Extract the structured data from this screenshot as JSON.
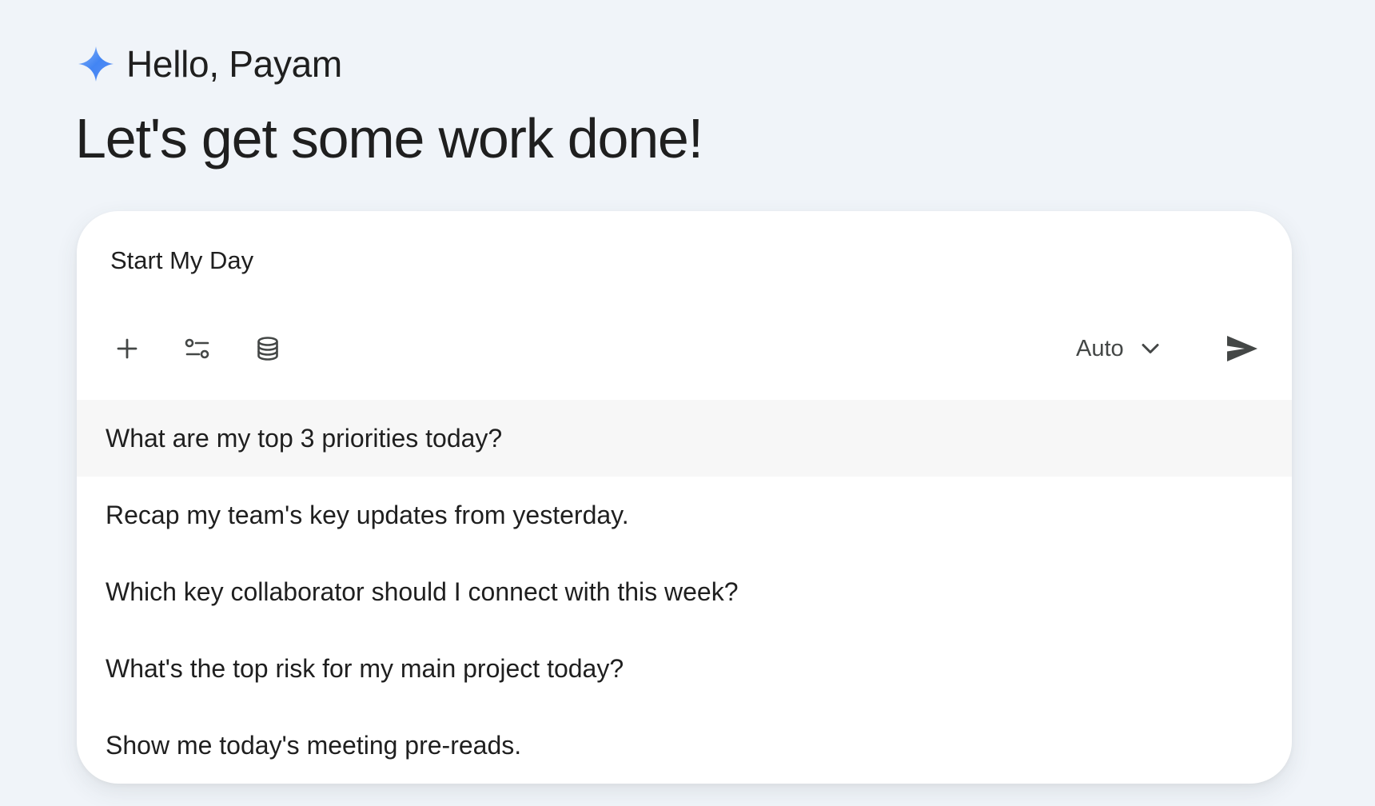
{
  "greeting": {
    "icon": "sparkle-icon",
    "text": "Hello, Payam"
  },
  "headline": "Let's get some work done!",
  "prompt": {
    "value": "Start My Day",
    "toolbar": {
      "add_icon": "plus-icon",
      "tools_icon": "tools-sliders-icon",
      "sources_icon": "database-icon"
    },
    "mode": {
      "selected": "Auto",
      "icon": "chevron-down-icon"
    },
    "send_icon": "send-icon"
  },
  "suggestions": [
    "What are my top 3 priorities today?",
    "Recap my team's key updates from yesterday.",
    "Which key collaborator should I connect with this week?",
    "What's the top risk for my main project today?",
    "Show me today's meeting pre-reads."
  ],
  "colors": {
    "background": "#f0f4f9",
    "card": "#ffffff",
    "highlight": "#f7f7f7",
    "text": "#1f1f1f",
    "icon": "#444746",
    "sparkle_start": "#4285f4",
    "sparkle_end": "#8ab4f8"
  }
}
